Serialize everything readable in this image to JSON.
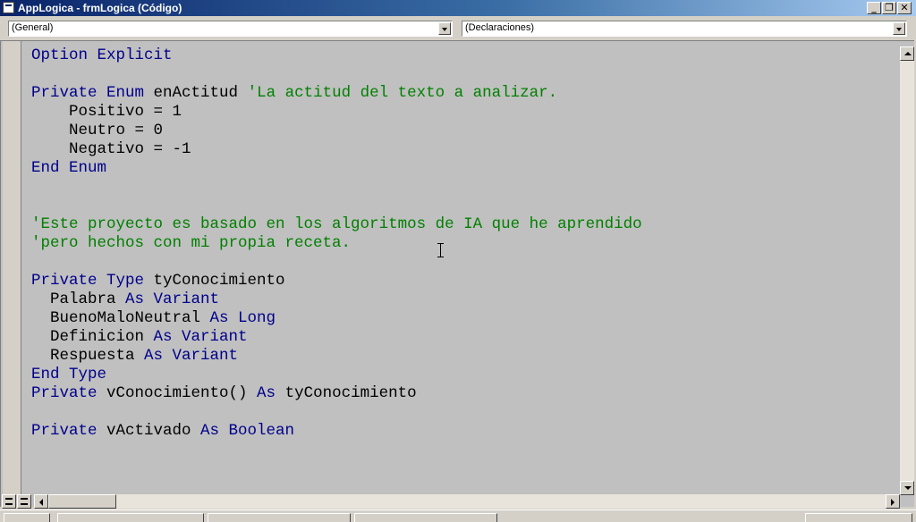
{
  "window": {
    "title": "AppLogica - frmLogica (Código)",
    "controls": [
      "minimize",
      "restore",
      "close"
    ]
  },
  "object_combo": {
    "value": "(General)"
  },
  "procedure_combo": {
    "value": "(Declaraciones)"
  },
  "code_lines": [
    [
      {
        "t": "Option Explicit",
        "c": "kw"
      }
    ],
    [],
    [
      {
        "t": "Private Enum",
        "c": "kw"
      },
      {
        "t": " enActitud ",
        "c": "tx"
      },
      {
        "t": "'La actitud del texto a analizar.",
        "c": "cm"
      }
    ],
    [
      {
        "t": "    Positivo = 1",
        "c": "tx"
      }
    ],
    [
      {
        "t": "    Neutro = 0",
        "c": "tx"
      }
    ],
    [
      {
        "t": "    Negativo = -1",
        "c": "tx"
      }
    ],
    [
      {
        "t": "End Enum",
        "c": "kw"
      }
    ],
    [],
    [],
    [
      {
        "t": "'Este proyecto es basado en los algoritmos de IA que he aprendido",
        "c": "cm"
      }
    ],
    [
      {
        "t": "'pero hechos con mi propia receta.",
        "c": "cm"
      }
    ],
    [],
    [
      {
        "t": "Private Type",
        "c": "kw"
      },
      {
        "t": " tyConocimiento",
        "c": "tx"
      }
    ],
    [
      {
        "t": "  Palabra ",
        "c": "tx"
      },
      {
        "t": "As Variant",
        "c": "kw"
      }
    ],
    [
      {
        "t": "  BuenoMaloNeutral ",
        "c": "tx"
      },
      {
        "t": "As Long",
        "c": "kw"
      }
    ],
    [
      {
        "t": "  Definicion ",
        "c": "tx"
      },
      {
        "t": "As Variant",
        "c": "kw"
      }
    ],
    [
      {
        "t": "  Respuesta ",
        "c": "tx"
      },
      {
        "t": "As Variant",
        "c": "kw"
      }
    ],
    [
      {
        "t": "End Type",
        "c": "kw"
      }
    ],
    [
      {
        "t": "Private",
        "c": "kw"
      },
      {
        "t": " vConocimiento() ",
        "c": "tx"
      },
      {
        "t": "As",
        "c": "kw"
      },
      {
        "t": " tyConocimiento",
        "c": "tx"
      }
    ],
    [],
    [
      {
        "t": "Private",
        "c": "kw"
      },
      {
        "t": " vActivado ",
        "c": "tx"
      },
      {
        "t": "As Boolean",
        "c": "kw"
      }
    ]
  ],
  "colors": {
    "keyword": "#00008b",
    "comment": "#008000",
    "text": "#000000",
    "editor_background": "#c0c0c0"
  },
  "icons": {
    "minimize": "minimize-icon",
    "restore": "restore-icon",
    "close": "close-icon",
    "procedure_view": "procedure-view-icon",
    "module_view": "full-module-view-icon"
  }
}
